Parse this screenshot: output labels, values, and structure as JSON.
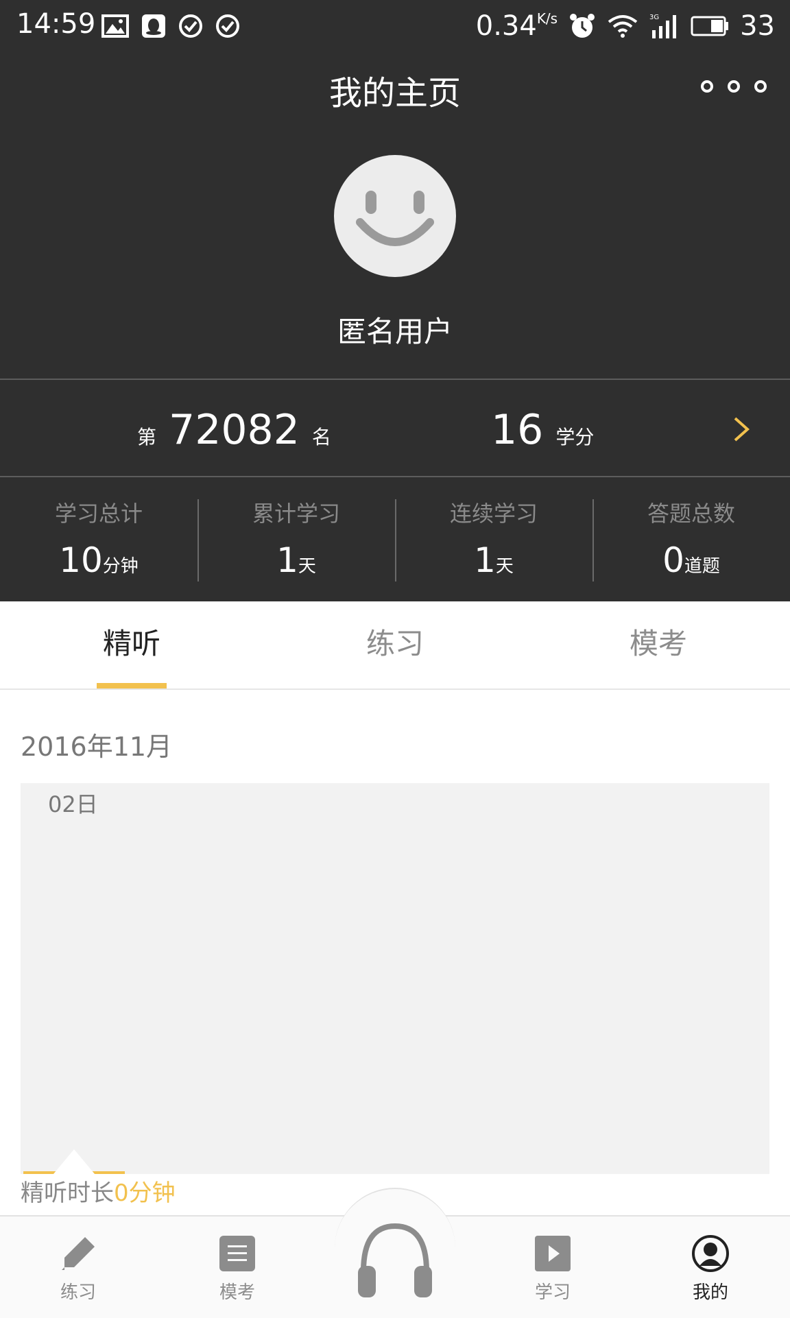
{
  "status_bar": {
    "time": "14:59",
    "speed": "0.34",
    "speed_unit": "K/s",
    "battery": "33",
    "icons": [
      "image-icon",
      "qq-icon",
      "check-circle-icon",
      "check-circle-icon",
      "alarm-icon",
      "wifi-icon",
      "signal-3g-icon",
      "battery-icon"
    ]
  },
  "header": {
    "title": "我的主页",
    "more_icon": "more-dots-icon"
  },
  "profile": {
    "username": "匿名用户",
    "avatar_icon": "smiley-avatar-icon"
  },
  "rank": {
    "prefix": "第",
    "value": "72082",
    "suffix": "名"
  },
  "credit": {
    "value": "16",
    "unit": "学分"
  },
  "stats": [
    {
      "label": "学习总计",
      "value": "10",
      "unit": "分钟"
    },
    {
      "label": "累计学习",
      "value": "1",
      "unit": "天"
    },
    {
      "label": "连续学习",
      "value": "1",
      "unit": "天"
    },
    {
      "label": "答题总数",
      "value": "0",
      "unit": "道题"
    }
  ],
  "tabs": [
    {
      "label": "精听",
      "active": true
    },
    {
      "label": "练习",
      "active": false
    },
    {
      "label": "模考",
      "active": false
    }
  ],
  "month": "2016年11月",
  "day": "02日",
  "listen_time": {
    "label": "精听时长",
    "value": "0分钟"
  },
  "bottom_nav": [
    {
      "label": "练习",
      "icon": "pencil-icon"
    },
    {
      "label": "模考",
      "icon": "list-doc-icon"
    },
    {
      "label": "",
      "icon": "headphones-icon"
    },
    {
      "label": "学习",
      "icon": "play-icon"
    },
    {
      "label": "我的",
      "icon": "user-icon",
      "active": true
    }
  ],
  "colors": {
    "accent": "#f2c14e",
    "dark_bg": "#2f2f2f"
  }
}
